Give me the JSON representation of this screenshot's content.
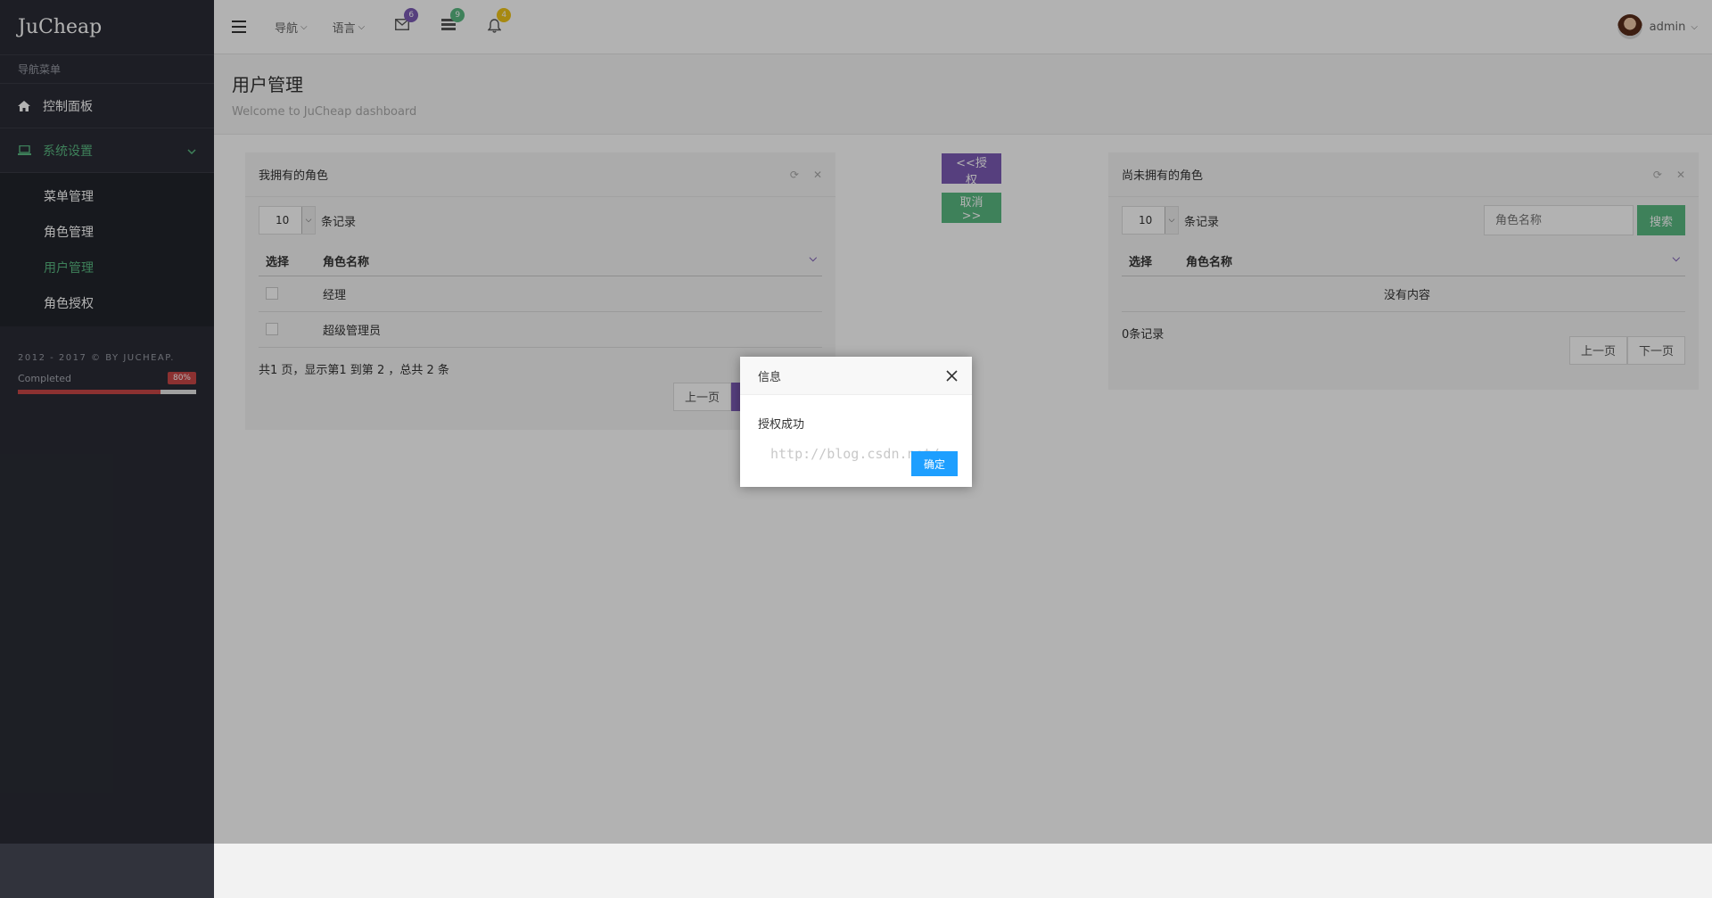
{
  "brand": "JuCheap",
  "sidebar": {
    "header": "导航菜单",
    "items": [
      {
        "label": "控制面板"
      },
      {
        "label": "系统设置"
      }
    ],
    "submenu": [
      {
        "label": "菜单管理"
      },
      {
        "label": "角色管理"
      },
      {
        "label": "用户管理"
      },
      {
        "label": "角色授权"
      }
    ],
    "copyright": "2012 - 2017 © BY JUCHEAP.",
    "progress_label": "Completed",
    "progress_badge": "80%",
    "progress_value": 0.8
  },
  "topbar": {
    "nav_menu": "导航",
    "lang_menu": "语言",
    "mail_count": "6",
    "tasks_count": "9",
    "bell_count": "4",
    "user": "admin"
  },
  "colors": {
    "mail_badge": "#7b5bb5",
    "tasks_badge": "#5ab982",
    "bell_badge": "#f0c419",
    "accent_green": "#5ab982",
    "accent_purple": "#7b5bb5",
    "dialog_ok": "#1e9fff"
  },
  "page": {
    "title": "用户管理",
    "subtitle": "Welcome to JuCheap dashboard"
  },
  "left_panel": {
    "title": "我拥有的角色",
    "page_length": "10",
    "length_label": "条记录",
    "columns": [
      "选择",
      "角色名称"
    ],
    "rows": [
      {
        "name": "经理"
      },
      {
        "name": "超级管理员"
      }
    ],
    "info": "共1 页，显示第1 到第 2 ，总共 2 条",
    "prev": "上一页"
  },
  "actions": {
    "grant": "<<授权",
    "cancel": "取消>>"
  },
  "right_panel": {
    "title": "尚未拥有的角色",
    "page_length": "10",
    "length_label": "条记录",
    "search_placeholder": "角色名称",
    "search_button": "搜索",
    "columns": [
      "选择",
      "角色名称"
    ],
    "empty": "没有内容",
    "info": "0条记录",
    "prev": "上一页",
    "next": "下一页"
  },
  "dialog": {
    "title": "信息",
    "message": "授权成功",
    "ok": "确定",
    "watermark": "http://blog.csdn.net/"
  },
  "icons": {
    "dashboard": "home-icon",
    "settings": "laptop-icon",
    "mail": "envelope-icon",
    "tasks": "tasks-icon",
    "bell": "bell-icon",
    "refresh": "refresh-icon",
    "close": "close-icon"
  }
}
